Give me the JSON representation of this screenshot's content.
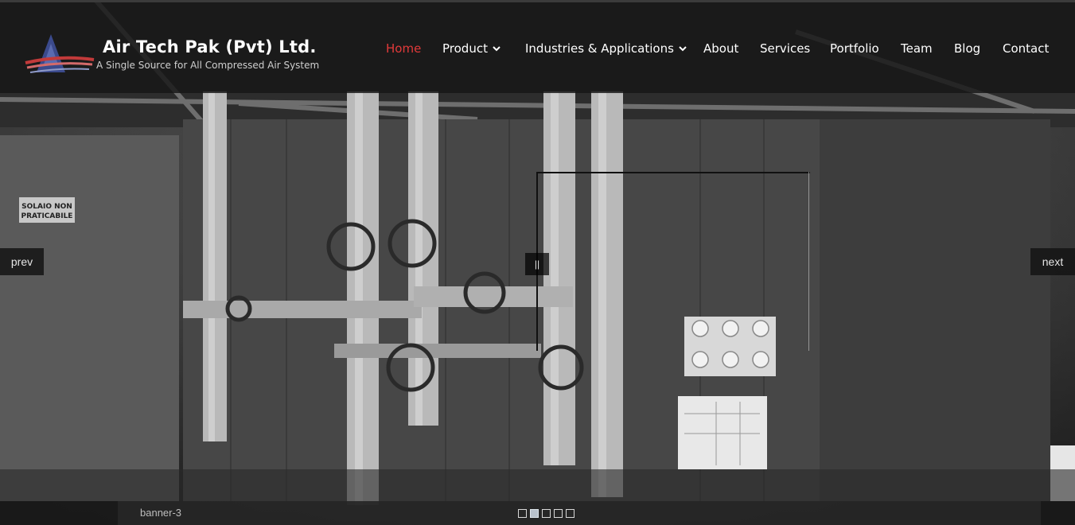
{
  "brand": {
    "title": "Air Tech Pak (Pvt) Ltd.",
    "subtitle": "A Single Source for All Compressed Air System"
  },
  "nav": {
    "items": [
      {
        "label": "Home",
        "active": true,
        "dropdown": false
      },
      {
        "label": "Product",
        "active": false,
        "dropdown": true
      },
      {
        "label": "Industries & Applications",
        "active": false,
        "dropdown": true
      },
      {
        "label": "About",
        "active": false,
        "dropdown": false
      },
      {
        "label": "Services",
        "active": false,
        "dropdown": false
      },
      {
        "label": "Portfolio",
        "active": false,
        "dropdown": false
      },
      {
        "label": "Team",
        "active": false,
        "dropdown": false
      },
      {
        "label": "Blog",
        "active": false,
        "dropdown": false
      },
      {
        "label": "Contact",
        "active": false,
        "dropdown": false
      }
    ],
    "active_color": "#e23a3a"
  },
  "slider": {
    "prev_label": "prev",
    "next_label": "next",
    "pause_label": "||",
    "caption": "banner-3",
    "slide_count": 5,
    "active_slide": 2
  },
  "photo": {
    "sign_line1": "SOLAIO NON",
    "sign_line2": "PRATICABILE"
  }
}
